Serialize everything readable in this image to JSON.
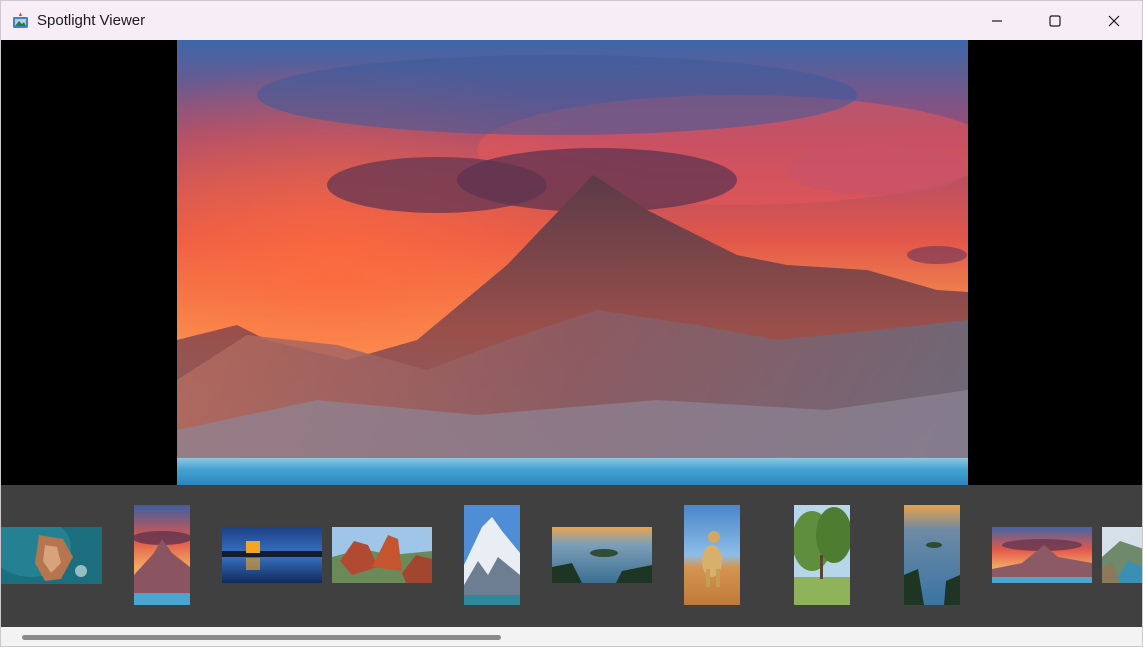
{
  "window": {
    "title": "Spotlight Viewer",
    "icons": {
      "app": "app-icon",
      "minimize": "minimize-icon",
      "maximize": "maximize-icon",
      "close": "close-icon"
    }
  },
  "viewer": {
    "image": "mountain-sunset-lake"
  },
  "thumbnails": [
    {
      "subject": "aerial-coastal-village"
    },
    {
      "subject": "mountain-sunset-portrait"
    },
    {
      "subject": "lighthouse-night-reflection"
    },
    {
      "subject": "red-rocks-desert"
    },
    {
      "subject": "snowy-peak-portrait"
    },
    {
      "subject": "lake-island-sunset"
    },
    {
      "subject": "cheetah-desert-portrait"
    },
    {
      "subject": "green-trees-meadow"
    },
    {
      "subject": "lake-island-portrait"
    },
    {
      "subject": "mountain-sunset-lake"
    },
    {
      "subject": "coastal-cliffs"
    }
  ],
  "colors": {
    "titlebar": "#f6edf6",
    "strip": "#404040",
    "viewer": "#000000",
    "scrollbar": "#8a8a8a"
  },
  "scrollbar": {
    "position_fraction": 0
  }
}
